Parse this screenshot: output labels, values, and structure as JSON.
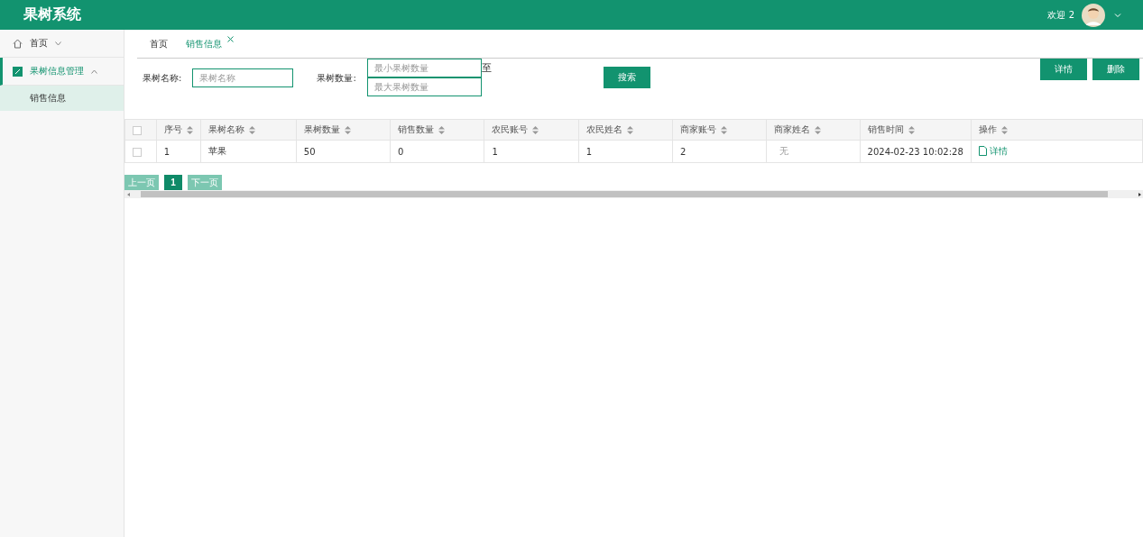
{
  "header": {
    "title": "果树系统",
    "greeting": "欢迎 2"
  },
  "sidebar": {
    "items": [
      {
        "label": "首页",
        "kind": "home",
        "expanded": false,
        "selected": false
      },
      {
        "label": "果树信息管理",
        "kind": "folder",
        "expanded": true,
        "selected": true,
        "children": [
          {
            "label": "销售信息",
            "selected": true
          }
        ]
      }
    ]
  },
  "tabs": [
    {
      "label": "首页",
      "selected": false,
      "closable": false
    },
    {
      "label": "销售信息",
      "selected": true,
      "closable": true
    }
  ],
  "filters": {
    "name": {
      "label": "果树名称:",
      "placeholder": "果树名称"
    },
    "quantity": {
      "label": "果树数量:",
      "min_placeholder": "最小果树数量",
      "max_placeholder": "最大果树数量",
      "separator": "至"
    },
    "search_button": "搜索"
  },
  "action_buttons": [
    "详情",
    "删除"
  ],
  "table": {
    "header_checked": false,
    "columns": [
      "序号",
      "果树名称",
      "果树数量",
      "销售数量",
      "农民账号",
      "农民姓名",
      "商家账号",
      "商家姓名",
      "销售时间",
      "操作"
    ],
    "rows": [
      {
        "checked": false,
        "cells": [
          {
            "text": "1",
            "muted": false
          },
          {
            "text": "苹果",
            "muted": false
          },
          {
            "text": "50",
            "muted": false
          },
          {
            "text": "0",
            "muted": false
          },
          {
            "text": "1",
            "muted": false
          },
          {
            "text": "1",
            "muted": false
          },
          {
            "text": "2",
            "muted": false
          },
          {
            "text": "无",
            "muted": true
          },
          {
            "text": "2024-02-23 10:02:28",
            "muted": false
          }
        ],
        "action": "详情"
      }
    ]
  },
  "pagination": {
    "prev": {
      "label": "上一页",
      "disabled": true
    },
    "pages": [
      {
        "label": "1",
        "selected": true
      }
    ],
    "next": {
      "label": "下一页",
      "disabled": true
    }
  }
}
